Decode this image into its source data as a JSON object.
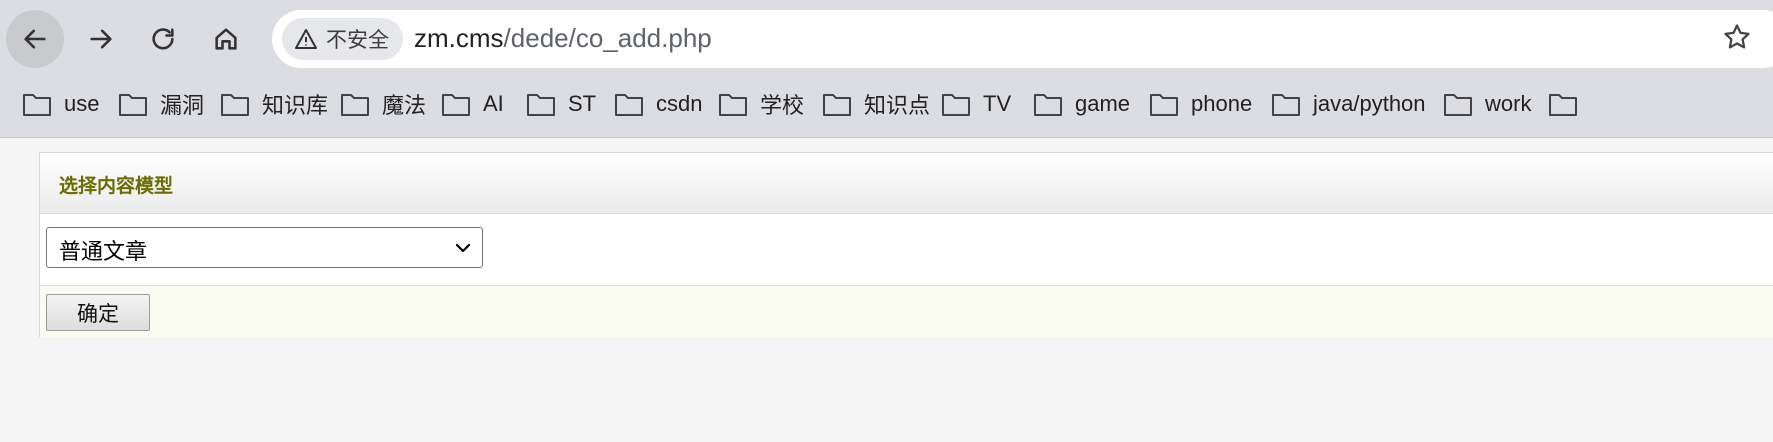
{
  "browser": {
    "security_label": "不安全",
    "url_host": "zm.cms",
    "url_path": "/dede/co_add.php",
    "icons": {
      "back": "arrow-left-icon",
      "forward": "arrow-right-icon",
      "reload": "reload-icon",
      "home": "home-icon",
      "security": "warning-triangle-icon",
      "bookmark_star": "star-icon",
      "folder": "folder-icon"
    }
  },
  "bookmarks": [
    {
      "label": "use"
    },
    {
      "label": "漏洞"
    },
    {
      "label": "知识库"
    },
    {
      "label": "魔法"
    },
    {
      "label": "AI"
    },
    {
      "label": "ST"
    },
    {
      "label": "csdn"
    },
    {
      "label": "学校"
    },
    {
      "label": "知识点"
    },
    {
      "label": "TV"
    },
    {
      "label": "game"
    },
    {
      "label": "phone"
    },
    {
      "label": "java/python"
    },
    {
      "label": "work"
    }
  ],
  "form": {
    "title": "选择内容模型",
    "model_selected": "普通文章",
    "confirm_label": "确定"
  },
  "colors": {
    "title": "#6b6b00",
    "button_row_bg": "#fbfcf1",
    "chrome_bg": "#dcdde2"
  }
}
